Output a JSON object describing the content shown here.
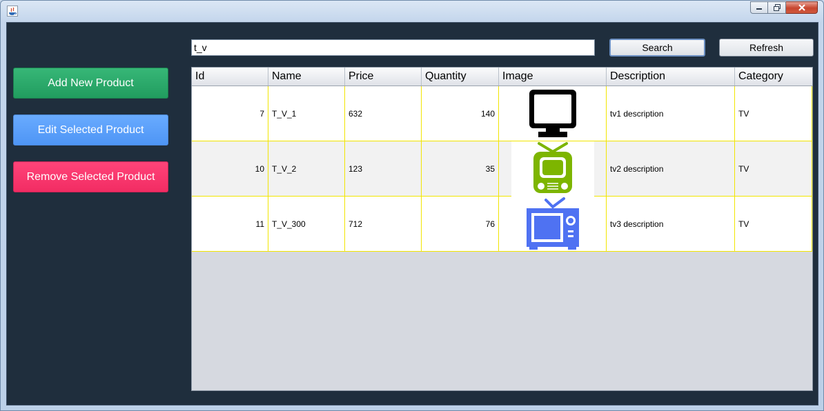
{
  "window": {
    "title": ""
  },
  "sidebar": {
    "add_label": "Add New Product",
    "edit_label": "Edit Selected Product",
    "remove_label": "Remove Selected Product"
  },
  "search": {
    "value": "t_v",
    "button_label": "Search",
    "refresh_label": "Refresh"
  },
  "table": {
    "columns": [
      "Id",
      "Name",
      "Price",
      "Quantity",
      "Image",
      "Description",
      "Category"
    ],
    "rows": [
      {
        "id": "7",
        "name": "T_V_1",
        "price": "632",
        "quantity": "140",
        "image_icon": "monitor-icon",
        "description": "tv1 description",
        "category": "TV"
      },
      {
        "id": "10",
        "name": "T_V_2",
        "price": "123",
        "quantity": "35",
        "image_icon": "retro-tv-icon",
        "description": "tv2 description",
        "category": "TV"
      },
      {
        "id": "11",
        "name": "T_V_300",
        "price": "712",
        "quantity": "76",
        "image_icon": "tv-antenna-icon",
        "description": "tv3 description",
        "category": "TV"
      }
    ]
  },
  "colors": {
    "background": "#1f2e3d",
    "add": "#2aa86a",
    "edit": "#5ba0fa",
    "remove": "#f83a6d",
    "grid": "#f2e500",
    "tv_green": "#7db500",
    "tv_blue": "#4f72f2"
  }
}
